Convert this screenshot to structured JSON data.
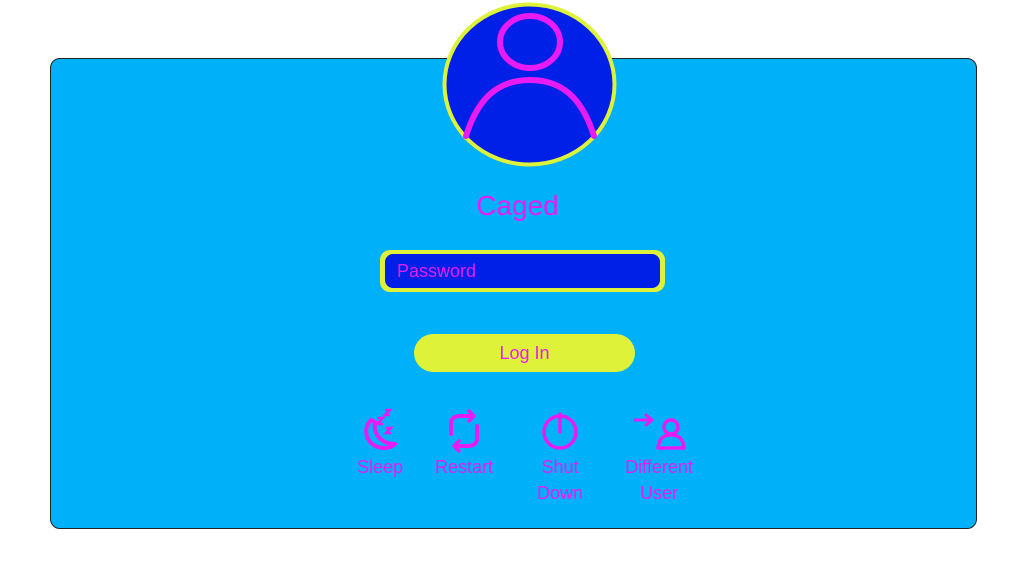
{
  "user": {
    "name": "Caged",
    "avatar_icon": "user-icon"
  },
  "password": {
    "placeholder": "Password",
    "value": ""
  },
  "login": {
    "label": "Log In"
  },
  "actions": [
    {
      "label": "Sleep",
      "icon": "sleep-icon"
    },
    {
      "label": "Restart",
      "icon": "restart-icon"
    },
    {
      "label": "Shut Down",
      "icon": "power-icon"
    },
    {
      "label": "Different User",
      "icon": "switch-user-icon"
    }
  ],
  "colors": {
    "panel": "#00b0f8",
    "accent": "#e81cf2",
    "highlight": "#dff23a",
    "field": "#0020e8"
  }
}
